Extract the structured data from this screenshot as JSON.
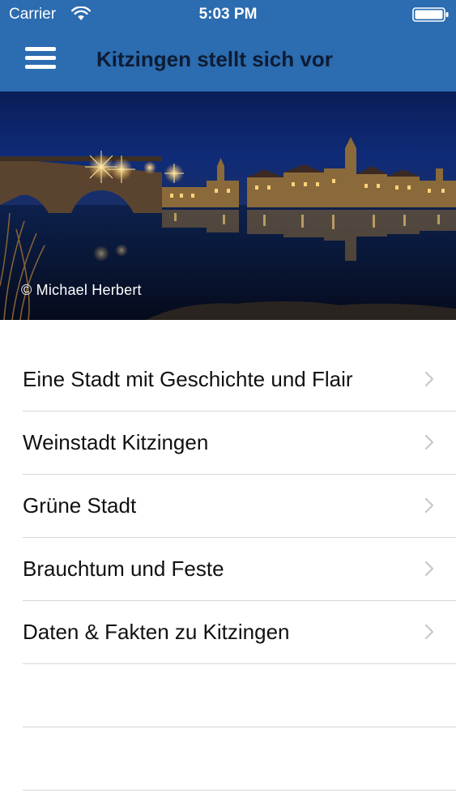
{
  "status_bar": {
    "carrier": "Carrier",
    "time": "5:03 PM",
    "wifi_icon": "wifi-icon",
    "battery_icon": "battery-full-icon"
  },
  "nav_bar": {
    "title": "Kitzingen stellt sich vor",
    "menu_icon": "hamburger-menu-icon",
    "background_color": "#2c6cb0"
  },
  "hero": {
    "credit": "© Michael Herbert"
  },
  "menu_items": [
    {
      "label": "Eine Stadt mit Geschichte und Flair"
    },
    {
      "label": "Weinstadt Kitzingen"
    },
    {
      "label": "Grüne Stadt"
    },
    {
      "label": "Brauchtum und Feste"
    },
    {
      "label": "Daten & Fakten zu Kitzingen"
    }
  ],
  "chevron_icon": "chevron-right-icon"
}
